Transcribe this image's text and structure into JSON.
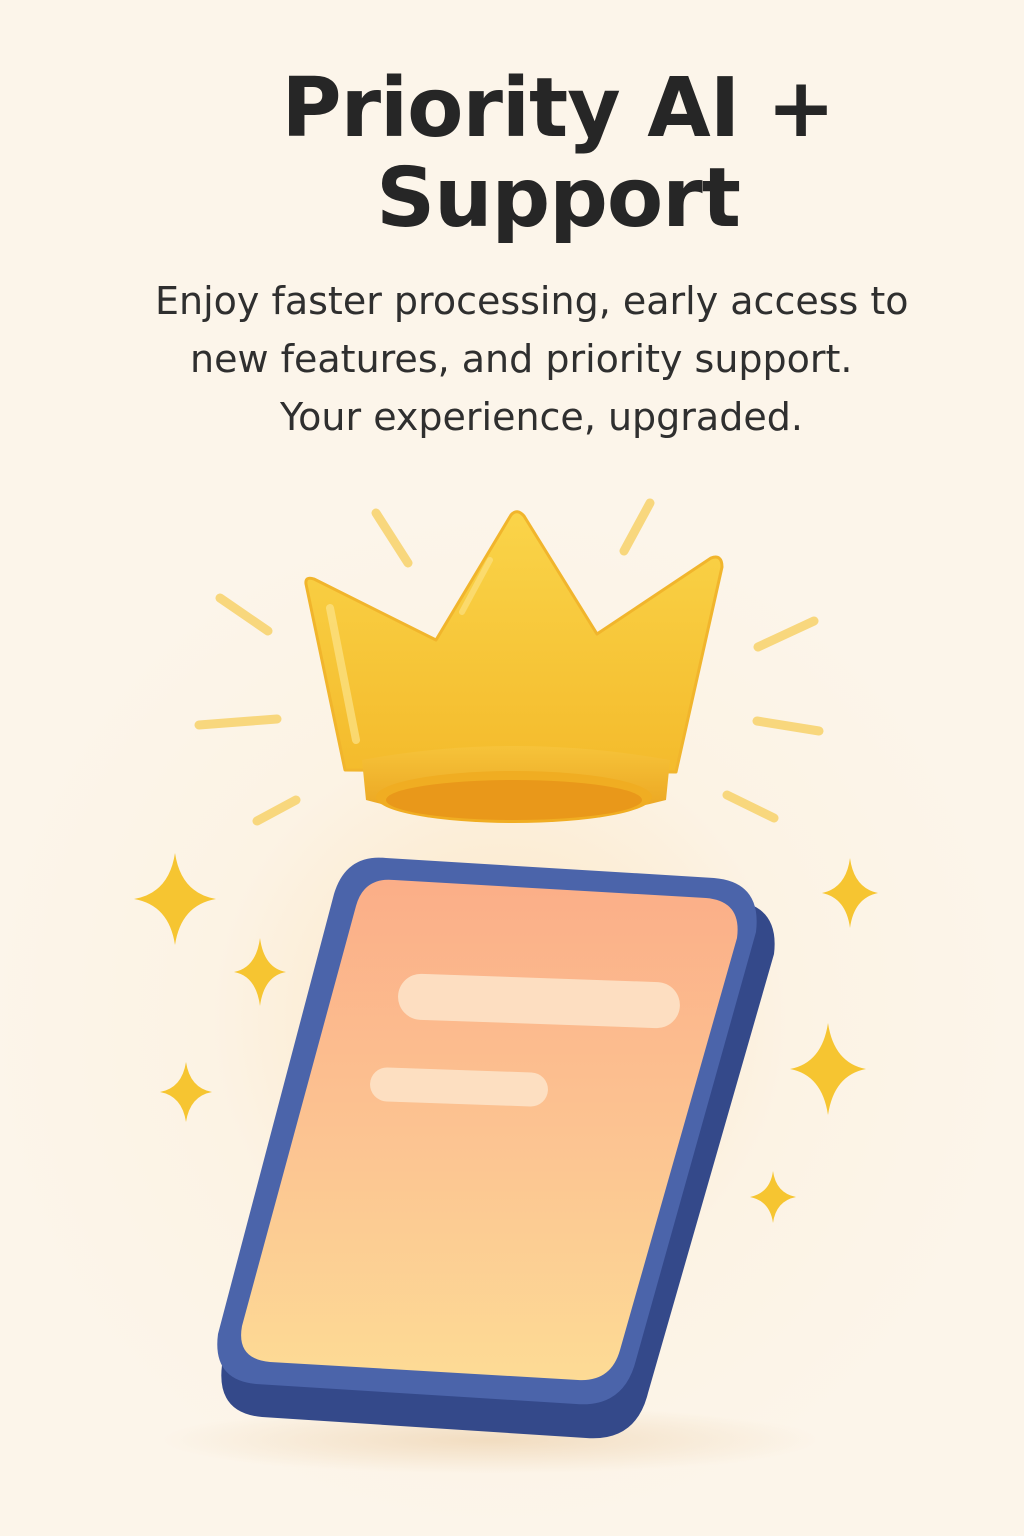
{
  "title": "Priority AI + Support",
  "subtitle": {
    "line1": "Enjoy faster processing, early access to",
    "line2": "new features, and priority support.",
    "line3": "Your experience, upgraded."
  },
  "icons": {
    "crown": "crown-icon",
    "phone": "smartphone-illustration",
    "sparkle": "sparkle-icon",
    "rays": "shine-rays"
  },
  "colors": {
    "background": "#fcf5ea",
    "crown_gold": "#f7c93a",
    "crown_shade": "#eaa21e",
    "phone_frame": "#3f5a9e",
    "phone_screen_top": "#fbb58c",
    "phone_screen_bottom": "#fcd893",
    "sparkle": "#f6c531",
    "title_text": "#262626"
  }
}
